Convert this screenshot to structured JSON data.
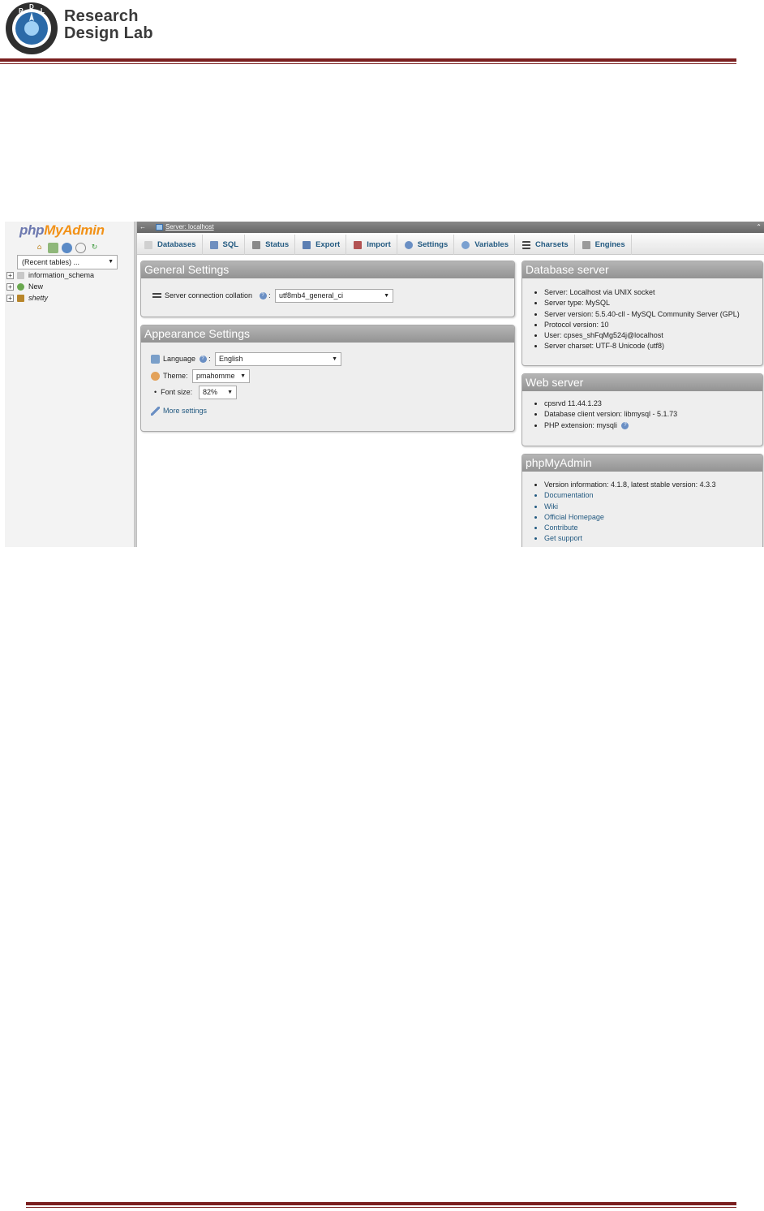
{
  "document": {
    "logo_text_line1": "Research",
    "logo_text_line2": "Design Lab",
    "logo_badge": "RDL",
    "accent_color": "#7a1f1f"
  },
  "navigation": {
    "logo_php": "php",
    "logo_myadmin": "MyAdmin",
    "icons": [
      "home-icon",
      "logout-icon",
      "query-window-icon",
      "documentation-icon",
      "reload-icon"
    ],
    "recent_tables": "(Recent tables) ...",
    "tree": [
      {
        "label": "information_schema",
        "icon": "database-icon",
        "italic": false
      },
      {
        "label": "New",
        "icon": "new-database-icon",
        "italic": false
      },
      {
        "label": "shetty",
        "icon": "database-icon",
        "italic": true
      }
    ]
  },
  "topbar": {
    "breadcrumb": "Server: localhost",
    "back_glyph": "←",
    "collapse_glyph": "⌃"
  },
  "tabs": [
    {
      "label": "Databases",
      "icon": "databases-icon",
      "color": "#c9c9c9"
    },
    {
      "label": "SQL",
      "icon": "sql-icon",
      "color": "#6f8fbf"
    },
    {
      "label": "Status",
      "icon": "status-icon",
      "color": "#8a8a8a"
    },
    {
      "label": "Export",
      "icon": "export-icon",
      "color": "#5c7fb3"
    },
    {
      "label": "Import",
      "icon": "import-icon",
      "color": "#b25252"
    },
    {
      "label": "Settings",
      "icon": "settings-icon",
      "color": "#6a8fc4"
    },
    {
      "label": "Variables",
      "icon": "variables-icon",
      "color": "#7aa0d0"
    },
    {
      "label": "Charsets",
      "icon": "charsets-icon",
      "color": "#444444"
    },
    {
      "label": "Engines",
      "icon": "engines-icon",
      "color": "#9a9a9a"
    }
  ],
  "general_settings": {
    "title": "General Settings",
    "collation_label": "Server connection collation",
    "collation_value": "utf8mb4_general_ci"
  },
  "appearance_settings": {
    "title": "Appearance Settings",
    "language_label": "Language",
    "language_value": "English",
    "theme_label": "Theme:",
    "theme_value": "pmahomme",
    "font_size_label": "Font size:",
    "font_size_value": "82%",
    "more_settings": "More settings"
  },
  "database_server": {
    "title": "Database server",
    "items": [
      "Server: Localhost via UNIX socket",
      "Server type: MySQL",
      "Server version: 5.5.40-cll - MySQL Community Server (GPL)",
      "Protocol version: 10",
      "User: cpses_shFqMg524j@localhost",
      "Server charset: UTF-8 Unicode (utf8)"
    ]
  },
  "web_server": {
    "title": "Web server",
    "items": [
      "cpsrvd 11.44.1.23",
      "Database client version: libmysql - 5.1.73",
      "PHP extension: mysqli"
    ]
  },
  "phpmyadmin_panel": {
    "title": "phpMyAdmin",
    "version": "Version information: 4.1.8, latest stable version: 4.3.3",
    "links": [
      "Documentation",
      "Wiki",
      "Official Homepage",
      "Contribute",
      "Get support"
    ]
  }
}
